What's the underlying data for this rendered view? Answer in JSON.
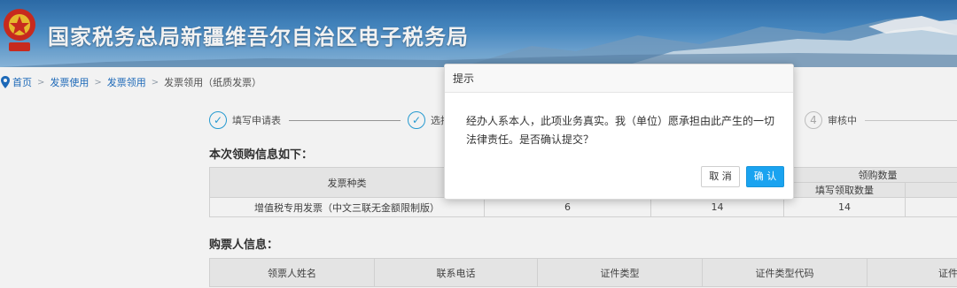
{
  "header": {
    "title": "国家税务总局新疆维吾尔自治区电子税务局"
  },
  "breadcrumb": {
    "items": [
      "首页",
      "发票使用",
      "发票领用"
    ],
    "separator": ">",
    "current": "发票领用（纸质发票）"
  },
  "steps": [
    {
      "label": "填写申请表",
      "status": "done",
      "mark": "✓"
    },
    {
      "label": "选择",
      "status": "done",
      "mark": "✓"
    },
    {
      "label": "审核中",
      "status": "pending",
      "mark": "4"
    }
  ],
  "invoice_section": {
    "title": "本次领购信息如下：",
    "headers": {
      "type": "发票种类",
      "quantity_group": "领购数量",
      "fill_quantity": "填写领取数量",
      "truncated": "领"
    },
    "row": {
      "type": "增值税专用发票（中文三联无金额限制版）",
      "col2": "6",
      "col3": "14",
      "fill_quantity": "14"
    }
  },
  "buyer_section": {
    "title": "购票人信息：",
    "headers": [
      "领票人姓名",
      "联系电话",
      "证件类型",
      "证件类型代码",
      "证件号"
    ]
  },
  "dialog": {
    "title": "提示",
    "message": "经办人系本人，此项业务真实。我（单位）愿承担由此产生的一切法律责任。是否确认提交？",
    "cancel_label": "取 消",
    "confirm_label": "确 认"
  },
  "colors": {
    "brand_blue": "#2e6fae",
    "link": "#1f6fc2",
    "step_accent": "#29a3dc",
    "confirm_button": "#1aa3f0"
  }
}
